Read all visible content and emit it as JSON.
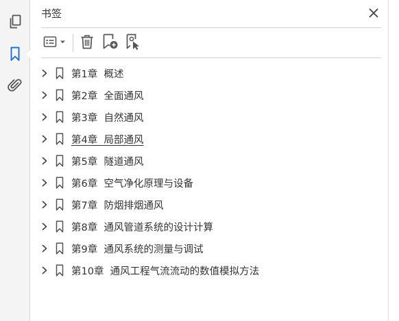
{
  "panel": {
    "title": "书签"
  },
  "bookmarks": [
    {
      "label": "第1章  概述"
    },
    {
      "label": "第2章  全面通风"
    },
    {
      "label": "第3章  自然通风"
    },
    {
      "label": "第4章  局部通风",
      "hovered": true
    },
    {
      "label": "第5章  隧道通风"
    },
    {
      "label": "第6章  空气净化原理与设备"
    },
    {
      "label": "第7章  防烟排烟通风"
    },
    {
      "label": "第8章  通风管道系统的设计计算"
    },
    {
      "label": "第9章  通风系统的测量与调试"
    },
    {
      "label": "第10章  通风工程气流流动的数值模拟方法"
    }
  ],
  "colors": {
    "accent": "#1f6fd1",
    "icon": "#555555",
    "text": "#333333",
    "rail_bg": "#f4f4f4"
  },
  "icons": {
    "rail": [
      "pages-icon",
      "bookmark-icon",
      "paperclip-icon"
    ],
    "toolbar": [
      "options-menu-icon",
      "trash-icon",
      "new-bookmark-icon",
      "bookmark-from-selection-icon"
    ],
    "close": "close-icon"
  }
}
